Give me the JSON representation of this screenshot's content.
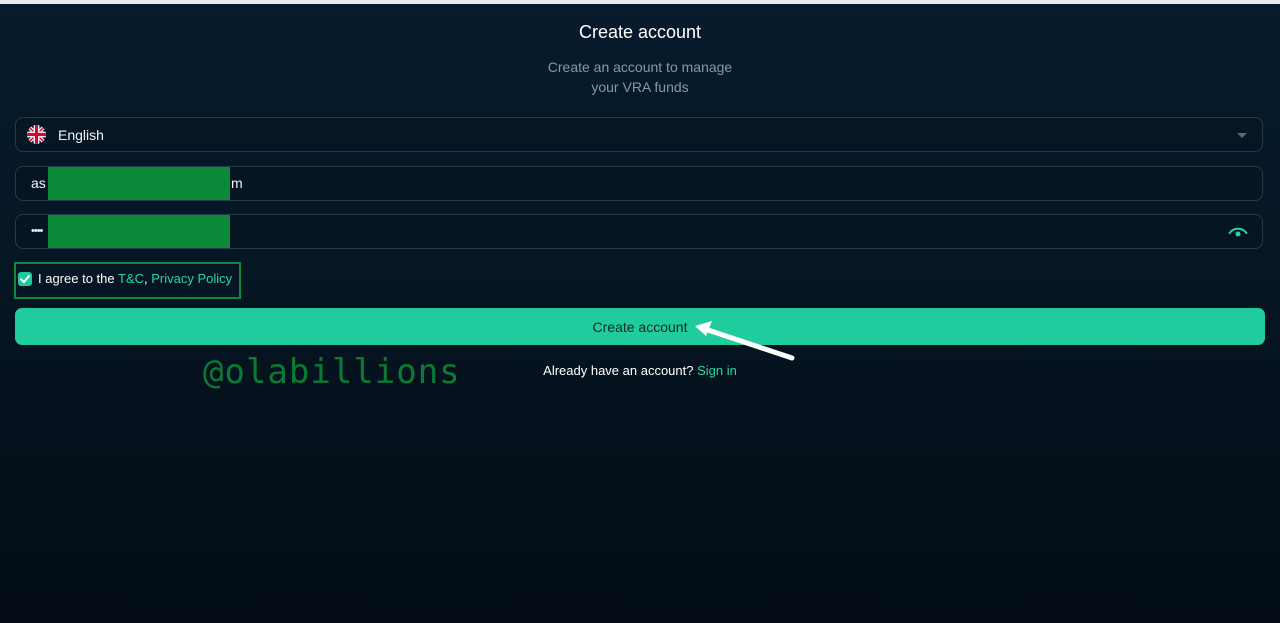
{
  "header": {
    "title": "Create account",
    "subtitle": "Create an account to manage your VRA funds"
  },
  "form": {
    "language": {
      "selected": "English",
      "flag_icon": "uk-flag-icon"
    },
    "email": {
      "visible_prefix": "as",
      "visible_suffix": "m"
    },
    "password": {
      "masked_value": "••••",
      "toggle_icon": "eye-icon"
    },
    "agree": {
      "checked": true,
      "text_prefix": "I agree to the ",
      "tc_link": "T&C",
      "separator": ", ",
      "privacy_link": "Privacy Policy"
    },
    "submit_label": "Create account"
  },
  "footer": {
    "prompt": "Already have an account? ",
    "signin_link": "Sign in"
  },
  "overlay": {
    "watermark": "@olabillions"
  },
  "colors": {
    "accent": "#20cc9e",
    "link": "#26d7a4",
    "redaction": "#0a8a39",
    "background": "#061726"
  }
}
